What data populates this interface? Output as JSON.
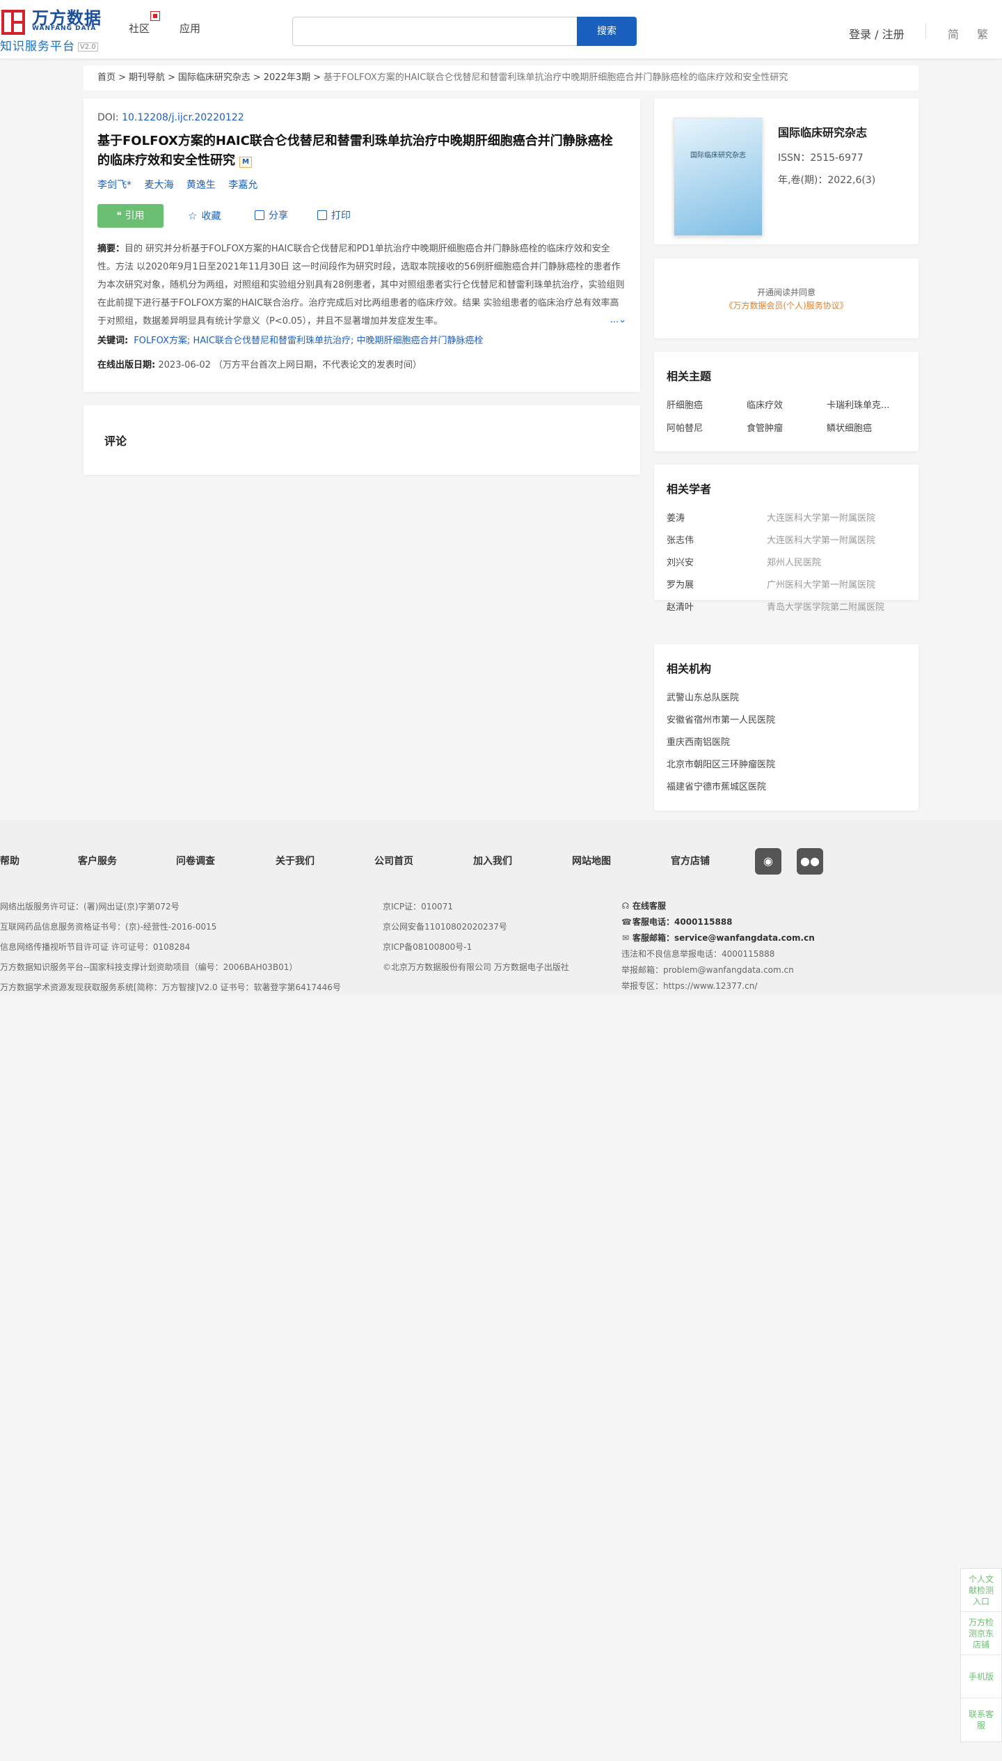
{
  "header": {
    "logo_cn": "万方数据",
    "logo_en": "WANFANG DATA",
    "logo_sub": "知识服务平台",
    "logo_version": "V2.0",
    "nav": [
      "社区",
      "应用"
    ],
    "search_placeholder": "",
    "search_button": "搜索",
    "login": "登录 / 注册",
    "lang_simplified": "简",
    "lang_traditional": "繁"
  },
  "breadcrumb": [
    "首页",
    "期刊导航",
    "国际临床研究杂志",
    "2022年3期",
    "基于FOLFOX方案的HAIC联合仑伐替尼和替雷利珠单抗治疗中晚期肝细胞癌合并门静脉癌栓的临床疗效和安全性研究"
  ],
  "article": {
    "doi_label": "DOI: ",
    "doi": "10.12208/j.ijcr.20220122",
    "title": "基于FOLFOX方案的HAIC联合仑伐替尼和替雷利珠单抗治疗中晚期肝细胞癌合并门静脉癌栓的临床疗效和安全性研究",
    "title_badge": "M",
    "authors": [
      "李剑飞*",
      "麦大海",
      "黄逸生",
      "李嘉允"
    ],
    "actions": {
      "cite": "引用",
      "favorite": "收藏",
      "share": "分享",
      "print": "打印"
    },
    "abstract_label": "摘要：",
    "abstract": "目的 研究并分析基于FOLFOX方案的HAIC联合仑伐替尼和PD1单抗治疗中晚期肝细胞癌合并门静脉癌栓的临床疗效和安全性。方法 以2020年9月1日至2021年11月30日 这一时间段作为研究时段，选取本院接收的56例肝细胞癌合并门静脉癌栓的患者作为本次研究对象，随机分为两组，对照组和实验组分别具有28例患者，其中对照组患者实行仑伐替尼和替雷利珠单抗治疗，实验组则在此前提下进行基于FOLFOX方案的HAIC联合治疗。治疗完成后对比两组患者的临床疗效。结果 实验组患者的临床治疗总有效率高于对照组，数据差异明显具有统计学意义（P<0.05），并且不显著增加并发症发生率。",
    "expand": "...",
    "keywords_label": "关键词:",
    "keywords": "FOLFOX方案; HAIC联合仑伐替尼和替雷利珠单抗治疗; 中晚期肝细胞癌合并门静脉癌栓",
    "pubdate_label": "在线出版日期:",
    "pubdate": "2023-06-02 （万方平台首次上网日期，不代表论文的发表时间）"
  },
  "comment": {
    "title": "评论"
  },
  "journal": {
    "cover_title": "国际临床研究杂志",
    "name": "国际临床研究杂志",
    "issn": "ISSN：2515-6977",
    "volume": "年,卷(期)：2022,6(3)"
  },
  "agreement": {
    "text": "开通阅读并同意",
    "link": "《万方数据会员(个人)服务协议》"
  },
  "topics": {
    "title": "相关主题",
    "items": [
      "肝细胞癌",
      "临床疗效",
      "卡瑞利珠单克...",
      "阿帕替尼",
      "食管肿瘤",
      "鳞状细胞癌"
    ]
  },
  "scholars": {
    "title": "相关学者",
    "items": [
      {
        "name": "姜涛",
        "institution": "大连医科大学第一附属医院"
      },
      {
        "name": "张志伟",
        "institution": "大连医科大学第一附属医院"
      },
      {
        "name": "刘兴安",
        "institution": "郑州人民医院"
      },
      {
        "name": "罗为展",
        "institution": "广州医科大学第一附属医院"
      },
      {
        "name": "赵清叶",
        "institution": "青岛大学医学院第二附属医院"
      }
    ]
  },
  "institutions": {
    "title": "相关机构",
    "items": [
      "武警山东总队医院",
      "安徽省宿州市第一人民医院",
      "重庆西南铝医院",
      "北京市朝阳区三环肿瘤医院",
      "福建省宁德市蕉城区医院"
    ]
  },
  "footer": {
    "nav": [
      "帮助",
      "客户服务",
      "问卷调查",
      "关于我们",
      "公司首页",
      "加入我们",
      "网站地图",
      "官方店铺"
    ],
    "social_icons": [
      "weibo-icon",
      "wechat-icon"
    ],
    "col1": [
      "网络出版服务许可证：(署)网出证(京)字第072号",
      "互联网药品信息服务资格证书号：(京)-经营性-2016-0015",
      "信息网络传播视听节目许可证 许可证号：0108284",
      "万方数据知识服务平台--国家科技支撑计划资助项目（编号：2006BAH03B01）",
      "万方数据学术资源发现获取服务系统[简称：万方智搜]V2.0 证书号：软著登字第6417446号"
    ],
    "col2": [
      "京ICP证：010071",
      "京公网安备11010802020237号",
      "京ICP备08100800号-1",
      "©北京万方数据股份有限公司 万方数据电子出版社"
    ],
    "online_service": "在线客服",
    "phone_label": "客服电话：",
    "phone": "4000115888",
    "email_label": "客服邮箱：",
    "email": "service@wanfangdata.com.cn",
    "report_phone": "违法和不良信息举报电话：4000115888",
    "report_email": "举报邮箱：problem@wanfangdata.com.cn",
    "report_zone": "举报专区：https://www.12377.cn/"
  },
  "float_menu": [
    "个人文献检测入口",
    "万方检测京东店铺",
    "手机版",
    "联系客服"
  ]
}
